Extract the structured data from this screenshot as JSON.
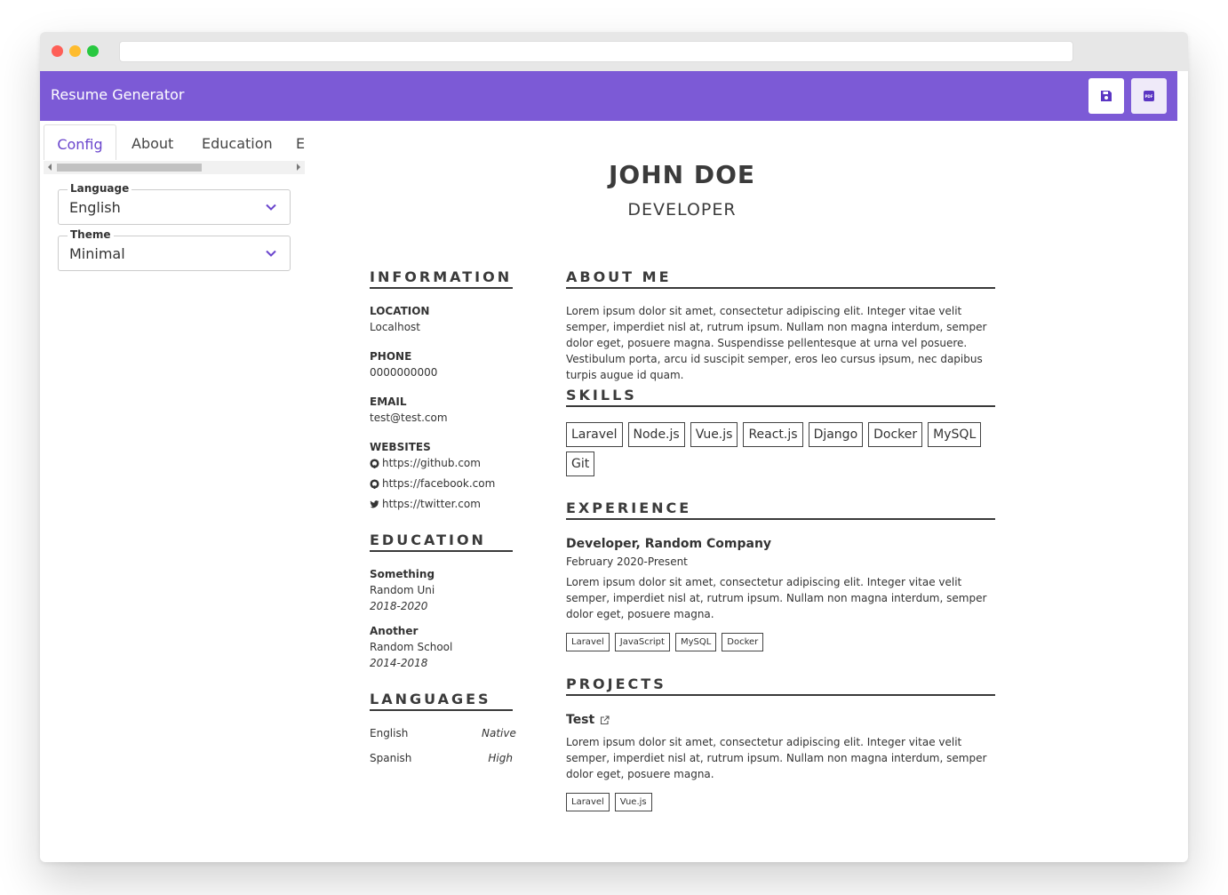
{
  "app": {
    "title": "Resume Generator"
  },
  "toolbar": {
    "save_icon": "save-icon",
    "pdf_icon": "pdf-icon",
    "pdf_badge": "PDF",
    "accent": "#7c5ad6"
  },
  "sidebar": {
    "tabs": [
      "Config",
      "About",
      "Education",
      "E"
    ],
    "language": {
      "label": "Language",
      "value": "English"
    },
    "theme": {
      "label": "Theme",
      "value": "Minimal"
    }
  },
  "resume": {
    "name": "JOHN DOE",
    "role": "DEVELOPER",
    "information": {
      "heading": "INFORMATION",
      "location": {
        "label": "LOCATION",
        "value": "Localhost"
      },
      "phone": {
        "label": "PHONE",
        "value": "0000000000"
      },
      "email": {
        "label": "EMAIL",
        "value": "test@test.com"
      },
      "websites": {
        "label": "WEBSITES",
        "items": [
          {
            "icon": "github-icon",
            "url": "https://github.com"
          },
          {
            "icon": "github-icon",
            "url": "https://facebook.com"
          },
          {
            "icon": "twitter-icon",
            "url": "https://twitter.com"
          }
        ]
      }
    },
    "education": {
      "heading": "EDUCATION",
      "items": [
        {
          "degree": "Something",
          "school": "Random Uni",
          "years": "2018-2020"
        },
        {
          "degree": "Another",
          "school": "Random School",
          "years": "2014-2018"
        }
      ]
    },
    "languages": {
      "heading": "LANGUAGES",
      "items": [
        {
          "name": "English",
          "level": "Native"
        },
        {
          "name": "Spanish",
          "level": "High"
        }
      ]
    },
    "about": {
      "heading": "ABOUT ME",
      "text": "Lorem ipsum dolor sit amet, consectetur adipiscing elit. Integer vitae velit semper, imperdiet nisl at, rutrum ipsum. Nullam non magna interdum, semper dolor eget, posuere magna. Suspendisse pellentesque at urna vel posuere. Vestibulum porta, arcu id suscipit semper, eros leo cursus ipsum, nec dapibus turpis augue id quam."
    },
    "skills": {
      "heading": "SKILLS",
      "items": [
        "Laravel",
        "Node.js",
        "Vue.js",
        "React.js",
        "Django",
        "Docker",
        "MySQL",
        "Git"
      ]
    },
    "experience": {
      "heading": "EXPERIENCE",
      "title": "Developer, Random Company",
      "period": "February 2020-Present",
      "text": "Lorem ipsum dolor sit amet, consectetur adipiscing elit. Integer vitae velit semper, imperdiet nisl at, rutrum ipsum. Nullam non magna interdum, semper dolor eget, posuere magna.",
      "tags": [
        "Laravel",
        "JavaScript",
        "MySQL",
        "Docker"
      ]
    },
    "projects": {
      "heading": "PROJECTS",
      "title": "Test",
      "text": "Lorem ipsum dolor sit amet, consectetur adipiscing elit. Integer vitae velit semper, imperdiet nisl at, rutrum ipsum. Nullam non magna interdum, semper dolor eget, posuere magna.",
      "tags": [
        "Laravel",
        "Vue.js"
      ]
    }
  }
}
